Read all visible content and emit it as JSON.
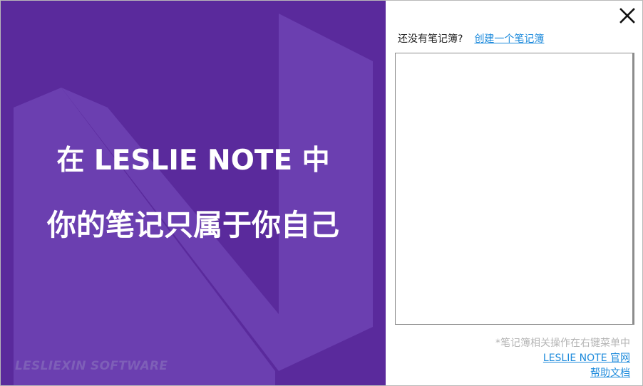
{
  "colors": {
    "brand_bg": "#5a2a9c",
    "brand_shape": "#6b3fb0",
    "brand_footer": "#7e5fb8",
    "link": "#1e8bdc"
  },
  "brand": {
    "line1": "在 LESLIE NOTE 中",
    "line2": "你的笔记只属于你自己",
    "footer": "LESLIEXIN SOFTWARE",
    "logo_icon": "n-logo-icon"
  },
  "header": {
    "close_icon": "close-icon"
  },
  "notebook_prompt": {
    "text": "还没有笔记簿?",
    "create_link": "创建一个笔记簿"
  },
  "notebook_list": {
    "items": []
  },
  "footer": {
    "hint": "*笔记簿相关操作在右键菜单中",
    "official_site_link": "LESLIE NOTE 官网",
    "help_link": "帮助文档"
  }
}
